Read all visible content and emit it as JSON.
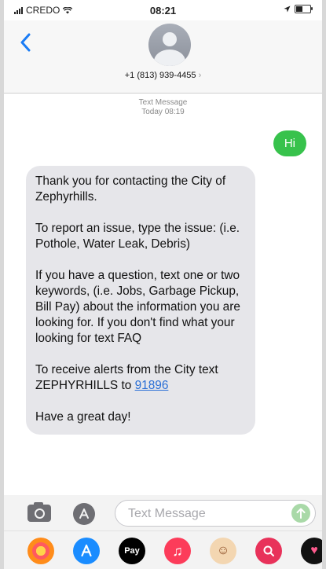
{
  "status_bar": {
    "carrier": "CREDO",
    "time": "08:21"
  },
  "header": {
    "contact_number": "+1 (813) 939-4455",
    "chevron": "›"
  },
  "thread": {
    "service_label": "Text Message",
    "timestamp": "Today 08:19",
    "outgoing": "Hi",
    "incoming": {
      "p1": "Thank you for contacting the City of Zephyrhills.",
      "p2": "To report an issue, type the issue: (i.e. Pothole, Water Leak, Debris)",
      "p3": "If you have a question, text one or two keywords, (i.e. Jobs, Garbage Pickup, Bill Pay) about the information you are looking for. If you don't find what your looking for text FAQ",
      "p4_prefix": "To receive alerts from the City text ZEPHYRHILLS to ",
      "p4_link": "91896",
      "p5": "Have a great day!"
    }
  },
  "composer": {
    "placeholder": "Text Message"
  },
  "app_strip": {
    "icons": [
      "photos-icon",
      "app-store-icon",
      "apple-pay-icon",
      "music-icon",
      "memoji-icon",
      "image-search-icon",
      "digital-touch-icon"
    ],
    "pay_label": "Pay"
  },
  "colors": {
    "outgoing_bubble": "#37c24c",
    "incoming_bubble": "#e6e6ea",
    "accent_blue": "#1a7cf5",
    "link": "#2a6fd6"
  }
}
